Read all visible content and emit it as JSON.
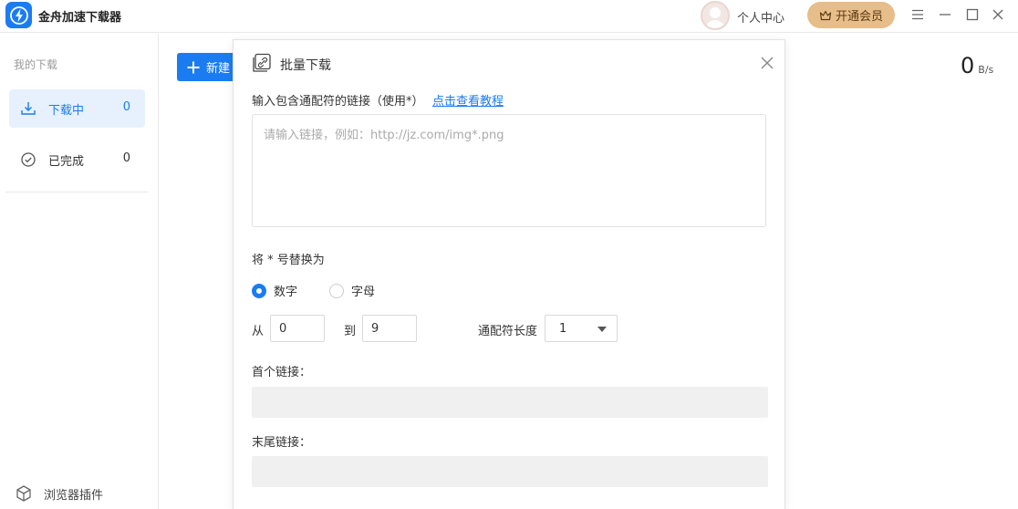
{
  "app": {
    "title": "金舟加速下载器",
    "user_center": "个人中心",
    "vip_label": "开通会员",
    "brand_color": "#1b7cf2",
    "vip_color": "#e7bd8a"
  },
  "sidebar": {
    "heading": "我的下载",
    "items": [
      {
        "label": "下载中",
        "count": "0",
        "icon": "download-icon",
        "active": true
      },
      {
        "label": "已完成",
        "count": "0",
        "icon": "check-circle-icon",
        "active": false
      }
    ],
    "plugin_label": "浏览器插件"
  },
  "main": {
    "new_button_label": "新建",
    "speed_value": "0",
    "speed_unit": "B/s"
  },
  "dialog": {
    "title": "批量下载",
    "link_label": "输入包含通配符的链接（使用*）",
    "tutorial_link": "点击查看教程",
    "link_placeholder": "请输入链接，例如：http://jz.com/img*.png",
    "link_value": "",
    "replace_label": "将 * 号替换为",
    "options": [
      {
        "label": "数字",
        "checked": true
      },
      {
        "label": "字母",
        "checked": false
      }
    ],
    "from_label": "从",
    "from_value": "0",
    "to_label": "到",
    "to_value": "9",
    "wildcard_length_label": "通配符长度",
    "wildcard_length_value": "1",
    "first_link_label": "首个链接：",
    "first_link_value": "",
    "last_link_label": "末尾链接：",
    "last_link_value": ""
  }
}
